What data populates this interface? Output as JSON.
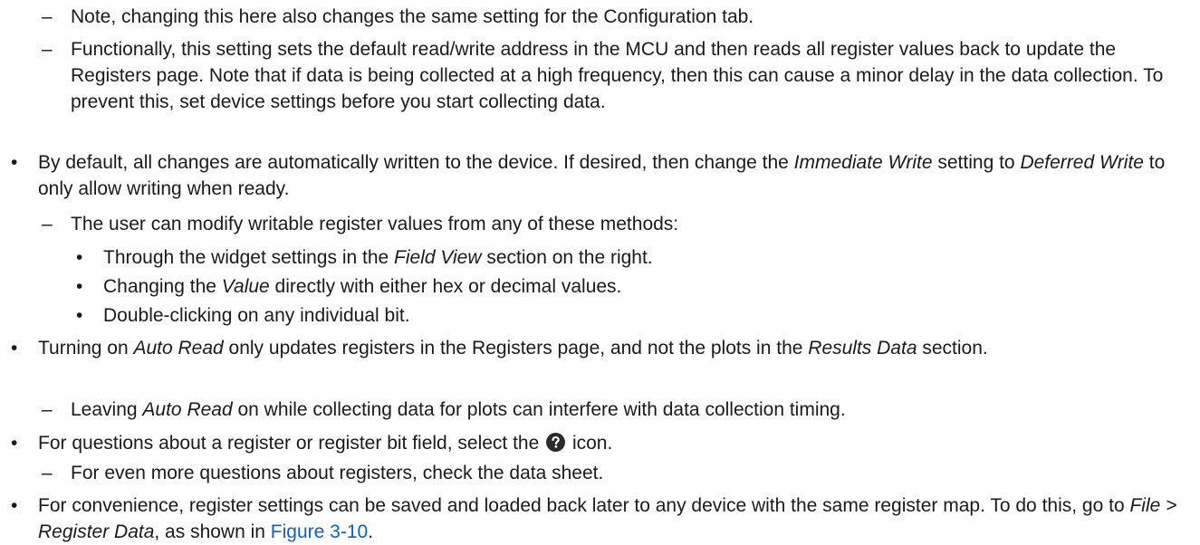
{
  "markers": {
    "bullet": "•",
    "dash": "–"
  },
  "items": [
    {
      "level": 2,
      "marker": "dash",
      "segments": [
        {
          "t": "Note, changing this here also changes the same setting for the Configuration tab."
        }
      ]
    },
    {
      "level": 2,
      "marker": "dash",
      "segments": [
        {
          "t": "Functionally, this setting sets the default read/write address in the MCU and then reads all register values back to update the Registers page. Note that if data is being collected at a high frequency, then this can cause a minor delay in the data collection. To prevent this, set device settings before you start collecting data."
        }
      ]
    },
    {
      "level": 1,
      "marker": "bullet",
      "segments": [
        {
          "t": "By default, all changes are automatically written to the device. If desired, then change the "
        },
        {
          "t": "Immediate Write",
          "em": true
        },
        {
          "t": " setting to "
        },
        {
          "t": "Deferred Write",
          "em": true
        },
        {
          "t": " to only allow writing when ready."
        }
      ]
    },
    {
      "level": 2,
      "marker": "dash",
      "segments": [
        {
          "t": "The user can modify writable register values from any of these methods:"
        }
      ]
    },
    {
      "level": 3,
      "marker": "bullet",
      "segments": [
        {
          "t": "Through the widget settings in the "
        },
        {
          "t": "Field View",
          "em": true
        },
        {
          "t": " section on the right."
        }
      ]
    },
    {
      "level": 3,
      "marker": "bullet",
      "segments": [
        {
          "t": "Changing the "
        },
        {
          "t": "Value",
          "em": true
        },
        {
          "t": " directly with either hex or decimal values."
        }
      ]
    },
    {
      "level": 3,
      "marker": "bullet",
      "segments": [
        {
          "t": "Double-clicking on any individual bit."
        }
      ]
    },
    {
      "level": 1,
      "marker": "bullet",
      "segments": [
        {
          "t": "Turning on "
        },
        {
          "t": "Auto Read",
          "em": true
        },
        {
          "t": " only updates registers in the Registers page, and not the plots in the "
        },
        {
          "t": "Results Data",
          "em": true
        },
        {
          "t": " section."
        }
      ]
    },
    {
      "level": 2,
      "marker": "dash",
      "segments": [
        {
          "t": "Leaving "
        },
        {
          "t": "Auto Read",
          "em": true
        },
        {
          "t": " on while collecting data for plots can interfere with data collection timing."
        }
      ]
    },
    {
      "level": 1,
      "marker": "bullet",
      "segments": [
        {
          "t": "For questions about a register or register bit field, select the "
        },
        {
          "icon": "help-icon"
        },
        {
          "t": " icon."
        }
      ]
    },
    {
      "level": 2,
      "marker": "dash",
      "segments": [
        {
          "t": "For even more questions about registers, check the data sheet."
        }
      ]
    },
    {
      "level": 1,
      "marker": "bullet",
      "segments": [
        {
          "t": "For convenience, register settings can be saved and loaded back later to any device with the same register map. To do this, go to "
        },
        {
          "t": "File > Register Data",
          "em": true
        },
        {
          "t": ", as shown in "
        },
        {
          "t": "Figure 3-10",
          "link": true
        },
        {
          "t": "."
        }
      ]
    }
  ],
  "colors": {
    "text": "#1a1a1a",
    "link": "#0b63b7",
    "icon_fill": "#2b2b2b"
  }
}
